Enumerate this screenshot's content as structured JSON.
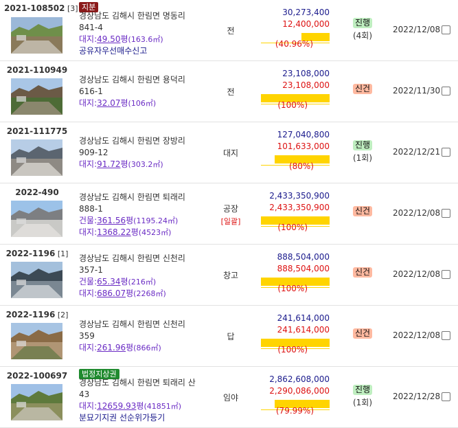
{
  "items": [
    {
      "case": "2021-108502",
      "sub": "[3]",
      "badge": "지분",
      "badge_color": "red",
      "addr1": "경상남도 김해시 한림면 명동리",
      "addr2": "841-4",
      "areas": [
        {
          "label": "대지:",
          "pyeong": "49.50",
          "unit": "평",
          "sqm": "(163.6㎡)"
        }
      ],
      "note": "공유자우선매수신고",
      "kind": "전",
      "kind_extra": "",
      "appraisal": "30,273,400",
      "min": "12,400,000",
      "pct": "(40.96%)",
      "pct_value": 40.96,
      "status": "진행",
      "status_count": "(4회)",
      "date": "2022/12/08"
    },
    {
      "case": "2021-110949",
      "sub": "",
      "badge": "",
      "badge_color": "",
      "addr1": "경상남도 김해시 한림면 용덕리",
      "addr2": "616-1",
      "areas": [
        {
          "label": "대지:",
          "pyeong": "32.07",
          "unit": "평",
          "sqm": "(106㎡)"
        }
      ],
      "note": "",
      "kind": "전",
      "kind_extra": "",
      "appraisal": "23,108,000",
      "min": "23,108,000",
      "pct": "(100%)",
      "pct_value": 100,
      "status": "신건",
      "status_count": "",
      "date": "2022/11/30"
    },
    {
      "case": "2021-111775",
      "sub": "",
      "badge": "",
      "badge_color": "",
      "addr1": "경상남도 김해시 한림면 장방리",
      "addr2": "909-12",
      "areas": [
        {
          "label": "대지:",
          "pyeong": "91.72",
          "unit": "평",
          "sqm": "(303.2㎡)"
        }
      ],
      "note": "",
      "kind": "대지",
      "kind_extra": "",
      "appraisal": "127,040,800",
      "min": "101,633,000",
      "pct": "(80%)",
      "pct_value": 80,
      "status": "진행",
      "status_count": "(1회)",
      "date": "2022/12/21"
    },
    {
      "case": "2022-490",
      "sub": "",
      "badge": "",
      "badge_color": "",
      "addr1": "경상남도 김해시 한림면 퇴래리",
      "addr2": "888-1",
      "areas": [
        {
          "label": "건물:",
          "pyeong": "361.56",
          "unit": "평",
          "sqm": "(1195.24㎡)"
        },
        {
          "label": "대지:",
          "pyeong": "1368.22",
          "unit": "평",
          "sqm": "(4523㎡)"
        }
      ],
      "note": "",
      "kind": "공장",
      "kind_extra": "[일괄]",
      "appraisal": "2,433,350,900",
      "min": "2,433,350,900",
      "pct": "(100%)",
      "pct_value": 100,
      "status": "신건",
      "status_count": "",
      "date": "2022/12/08"
    },
    {
      "case": "2022-1196",
      "sub": "[1]",
      "badge": "",
      "badge_color": "",
      "addr1": "경상남도 김해시 한림면 신천리",
      "addr2": "357-1",
      "areas": [
        {
          "label": "건물:",
          "pyeong": "65.34",
          "unit": "평",
          "sqm": "(216㎡)"
        },
        {
          "label": "대지:",
          "pyeong": "686.07",
          "unit": "평",
          "sqm": "(2268㎡)"
        }
      ],
      "note": "",
      "kind": "창고",
      "kind_extra": "",
      "appraisal": "888,504,000",
      "min": "888,504,000",
      "pct": "(100%)",
      "pct_value": 100,
      "status": "신건",
      "status_count": "",
      "date": "2022/12/08"
    },
    {
      "case": "2022-1196",
      "sub": "[2]",
      "badge": "",
      "badge_color": "",
      "addr1": "경상남도 김해시 한림면 신천리",
      "addr2": "359",
      "areas": [
        {
          "label": "대지:",
          "pyeong": "261.96",
          "unit": "평",
          "sqm": "(866㎡)"
        }
      ],
      "note": "",
      "kind": "답",
      "kind_extra": "",
      "appraisal": "241,614,000",
      "min": "241,614,000",
      "pct": "(100%)",
      "pct_value": 100,
      "status": "신건",
      "status_count": "",
      "date": "2022/12/08"
    },
    {
      "case": "2022-100697",
      "sub": "",
      "badge": "법정지상권",
      "badge_color": "green",
      "addr1": "경상남도 김해시 한림면 퇴래리 산",
      "addr2": "43",
      "areas": [
        {
          "label": "대지:",
          "pyeong": "12659.93",
          "unit": "평",
          "sqm": "(41851㎡)"
        }
      ],
      "note": "분묘기지권 선순위가등기",
      "kind": "임야",
      "kind_extra": "",
      "appraisal": "2,862,608,000",
      "min": "2,290,086,000",
      "pct": "(79.99%)",
      "pct_value": 79.99,
      "status": "진행",
      "status_count": "(1회)",
      "date": "2022/12/28"
    }
  ],
  "colors": {
    "appraisal": "#1a1a8c",
    "min_price": "#dd1111",
    "bar": "#ffd400",
    "badge_red": "#8b1a1a",
    "badge_green": "#1f8a2e",
    "status_progress": "#bfeec0",
    "status_new": "#ffb9a0",
    "area": "#6a2bc4"
  }
}
